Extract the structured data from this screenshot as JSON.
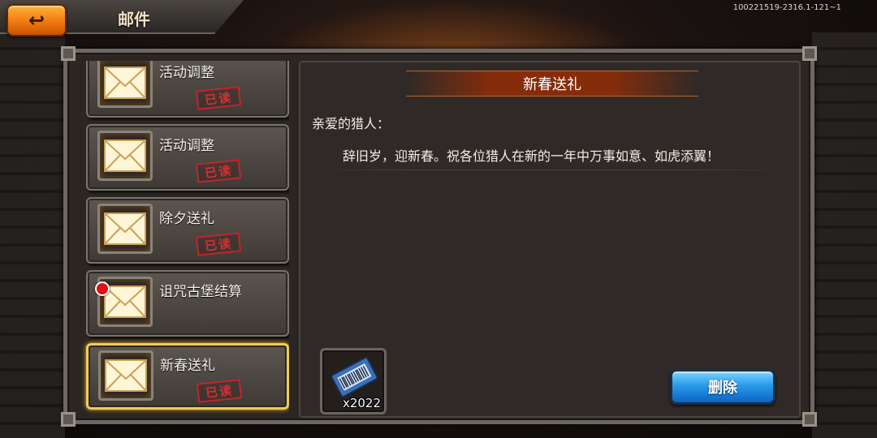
{
  "header": {
    "title": "邮件",
    "version": "100221519-2316.1-121~1",
    "back_icon": "↩"
  },
  "mail_list": {
    "items": [
      {
        "title": "活动调整",
        "read": true,
        "stamp": "已读",
        "icon": "envelope-icon"
      },
      {
        "title": "活动调整",
        "read": true,
        "stamp": "已读",
        "icon": "envelope-icon"
      },
      {
        "title": "除夕送礼",
        "read": true,
        "stamp": "已读",
        "icon": "envelope-icon"
      },
      {
        "title": "诅咒古堡结算",
        "read": false,
        "stamp": "",
        "icon": "envelope-icon"
      },
      {
        "title": "新春送礼",
        "read": true,
        "stamp": "已读",
        "icon": "envelope-icon",
        "selected": true
      }
    ]
  },
  "mail_detail": {
    "heading": "新春送礼",
    "greeting": "亲爱的猎人：",
    "body": "辞旧岁，迎新春。祝各位猎人在新的一年中万事如意、如虎添翼！",
    "reward": {
      "icon": "ticket-icon",
      "count": "x2022"
    },
    "delete_label": "删除"
  },
  "colors": {
    "accent_orange": "#f07a10",
    "delete_blue": "#2a9ae8",
    "selected_border": "#f0cc5a",
    "stamp_red": "#d33034",
    "unread_dot": "#e01010"
  }
}
